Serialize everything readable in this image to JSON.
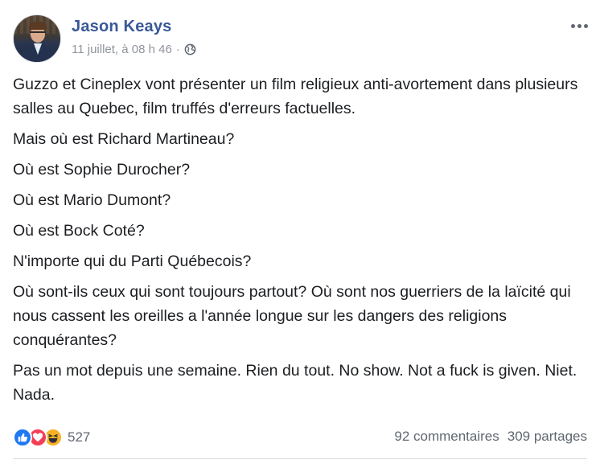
{
  "post": {
    "author": "Jason Keays",
    "timestamp": "11 juillet, à 08 h 46",
    "separator": "·",
    "privacy_icon": "globe-icon",
    "paragraphs": [
      "Guzzo et Cineplex vont présenter un film religieux anti-avortement dans plusieurs salles au Quebec, film truffés d'erreurs factuelles.",
      "Mais où est Richard Martineau?",
      "Où est Sophie Durocher?",
      "Où est Mario Dumont?",
      "Où est Bock Coté?",
      "N'importe qui du Parti Québecois?",
      "Où sont-ils ceux qui sont toujours partout? Où sont nos guerriers de la laïcité qui nous cassent les oreilles a l'année longue sur les dangers des religions conquérantes?",
      "Pas un mot depuis une semaine. Rien du tout. No show. Not a fuck is given. Niet. Nada."
    ]
  },
  "footer": {
    "reaction_icons": [
      "like-icon",
      "love-icon",
      "haha-icon"
    ],
    "reaction_count": "527",
    "comments": "92 commentaires",
    "shares": "309 partages"
  },
  "colors": {
    "author_link": "#385898",
    "meta_text": "#90949c",
    "body_text": "#1c1e21",
    "like": "#2078f4",
    "love": "#f33e58",
    "haha": "#f7b125"
  }
}
